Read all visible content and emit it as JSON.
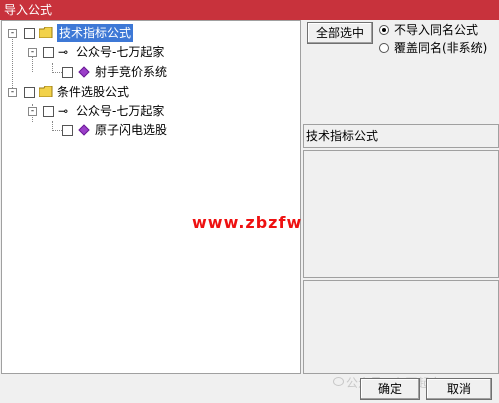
{
  "window": {
    "title": "导入公式"
  },
  "tree": {
    "nodes": [
      {
        "label": "技术指标公式",
        "selected": true
      },
      {
        "label": "公众号-七万起家"
      },
      {
        "label": "射手竞价系统"
      },
      {
        "label": "条件选股公式"
      },
      {
        "label": "公众号-七万起家"
      },
      {
        "label": "原子闪电选股"
      }
    ],
    "expand_symbol": "-"
  },
  "watermark": "www.zbzfwu.com",
  "right": {
    "select_all_label": "全部选中",
    "radio_options": [
      {
        "label": "不导入同名公式",
        "checked": true
      },
      {
        "label": "覆盖同名(非系统)",
        "checked": false
      }
    ],
    "info_label": "技术指标公式"
  },
  "footer": {
    "confirm_label": "确定",
    "cancel_label": "取消",
    "wechat_watermark": "公众号 · 七万起家"
  },
  "colors": {
    "titlebar": "#c8323c",
    "selection": "#3d78d6",
    "watermark": "#e11111"
  }
}
